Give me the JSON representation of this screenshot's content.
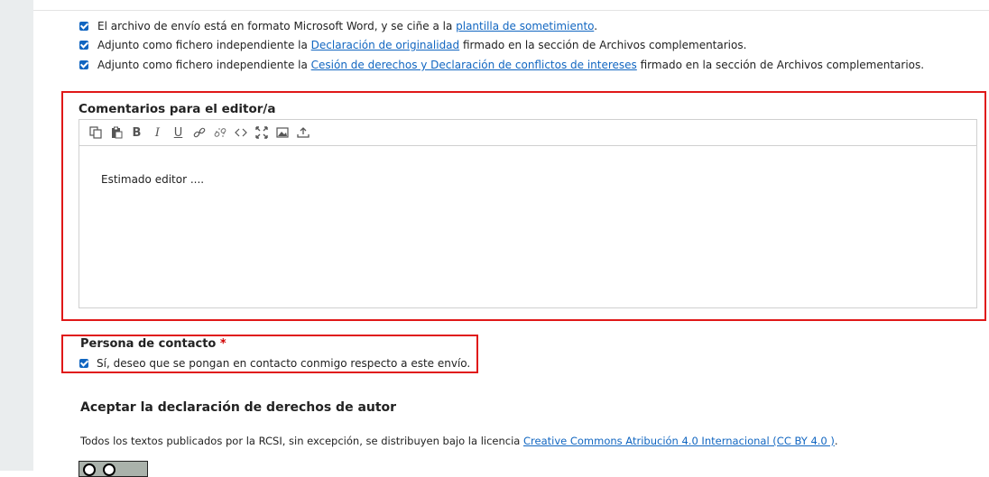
{
  "checklist": [
    {
      "before": "El archivo de envío está en formato Microsoft Word, y se ciñe a la ",
      "link": "plantilla de sometimiento",
      "after": "."
    },
    {
      "before": "Adjunto como fichero independiente la ",
      "link": "Declaración de originalidad",
      "after": " firmado en la sección de Archivos complementarios."
    },
    {
      "before": "Adjunto como fichero independiente la ",
      "link": "Cesión de derechos y Declaración de conflictos de intereses",
      "after": " firmado en la sección de Archivos complementarios."
    }
  ],
  "comments": {
    "title": "Comentarios para el editor/a",
    "body": "Estimado editor ....",
    "toolbar": [
      "copy-icon",
      "paste-icon",
      "bold-icon",
      "italic-icon",
      "underline-icon",
      "link-icon",
      "unlink-icon",
      "code-icon",
      "fullscreen-icon",
      "image-icon",
      "upload-icon"
    ],
    "toolbar_glyphs": {
      "bold": "B",
      "italic": "I",
      "underline": "U"
    }
  },
  "contact": {
    "title": "Persona de contacto",
    "required_mark": "*",
    "option": "Sí, deseo que se pongan en contacto conmigo respecto a este envío."
  },
  "copyright": {
    "title": "Aceptar la declaración de derechos de autor",
    "text_before": "Todos los textos publicados por la RCSI, sin excepción, se distribuyen bajo la licencia ",
    "link": "Creative Commons Atribución 4.0 Internacional (CC BY 4.0 )",
    "text_after": "."
  },
  "colors": {
    "highlight": "#e01818",
    "link": "#1166c1",
    "checkbox": "#1166c1"
  }
}
